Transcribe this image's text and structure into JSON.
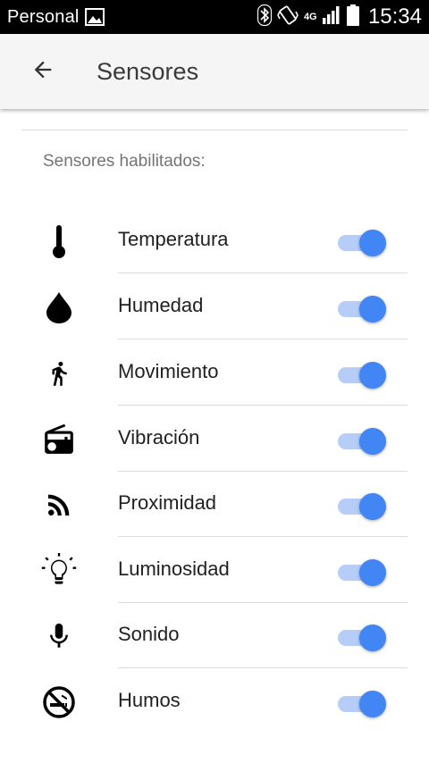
{
  "status_bar": {
    "carrier": "Personal",
    "network": "4G",
    "time": "15:34",
    "icons": [
      "image-icon",
      "bluetooth-icon",
      "vibrate-icon",
      "signal-icon",
      "battery-icon"
    ]
  },
  "app_bar": {
    "title": "Sensores",
    "back_icon": "arrow-back-icon"
  },
  "section_label": "Sensores habilitados:",
  "accent_color": "#4285f4",
  "sensors": [
    {
      "label": "Temperatura",
      "icon": "thermometer-icon",
      "enabled": true
    },
    {
      "label": "Humedad",
      "icon": "water-drop-icon",
      "enabled": true
    },
    {
      "label": "Movimiento",
      "icon": "walking-person-icon",
      "enabled": true
    },
    {
      "label": "Vibración",
      "icon": "radio-icon",
      "enabled": true
    },
    {
      "label": "Proximidad",
      "icon": "rss-feed-icon",
      "enabled": true
    },
    {
      "label": "Luminosidad",
      "icon": "light-bulb-icon",
      "enabled": true
    },
    {
      "label": "Sonido",
      "icon": "microphone-icon",
      "enabled": true
    },
    {
      "label": "Humos",
      "icon": "no-smoking-icon",
      "enabled": true
    }
  ]
}
